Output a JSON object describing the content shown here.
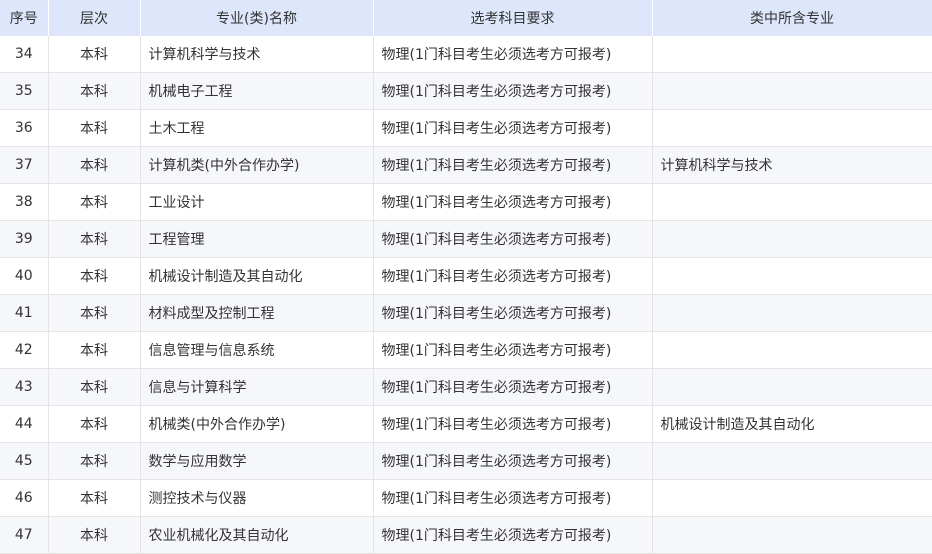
{
  "table": {
    "headers": [
      "序号",
      "层次",
      "专业(类)名称",
      "选考科目要求",
      "类中所含专业"
    ],
    "rows": [
      [
        "34",
        "本科",
        "计算机科学与技术",
        "物理(1门科目考生必须选考方可报考)",
        ""
      ],
      [
        "35",
        "本科",
        "机械电子工程",
        "物理(1门科目考生必须选考方可报考)",
        ""
      ],
      [
        "36",
        "本科",
        "土木工程",
        "物理(1门科目考生必须选考方可报考)",
        ""
      ],
      [
        "37",
        "本科",
        "计算机类(中外合作办学)",
        "物理(1门科目考生必须选考方可报考)",
        "计算机科学与技术"
      ],
      [
        "38",
        "本科",
        "工业设计",
        "物理(1门科目考生必须选考方可报考)",
        ""
      ],
      [
        "39",
        "本科",
        "工程管理",
        "物理(1门科目考生必须选考方可报考)",
        ""
      ],
      [
        "40",
        "本科",
        "机械设计制造及其自动化",
        "物理(1门科目考生必须选考方可报考)",
        ""
      ],
      [
        "41",
        "本科",
        "材料成型及控制工程",
        "物理(1门科目考生必须选考方可报考)",
        ""
      ],
      [
        "42",
        "本科",
        "信息管理与信息系统",
        "物理(1门科目考生必须选考方可报考)",
        ""
      ],
      [
        "43",
        "本科",
        "信息与计算科学",
        "物理(1门科目考生必须选考方可报考)",
        ""
      ],
      [
        "44",
        "本科",
        "机械类(中外合作办学)",
        "物理(1门科目考生必须选考方可报考)",
        "机械设计制造及其自动化"
      ],
      [
        "45",
        "本科",
        "数学与应用数学",
        "物理(1门科目考生必须选考方可报考)",
        ""
      ],
      [
        "46",
        "本科",
        "测控技术与仪器",
        "物理(1门科目考生必须选考方可报考)",
        ""
      ],
      [
        "47",
        "本科",
        "农业机械化及其自动化",
        "物理(1门科目考生必须选考方可报考)",
        ""
      ]
    ]
  }
}
